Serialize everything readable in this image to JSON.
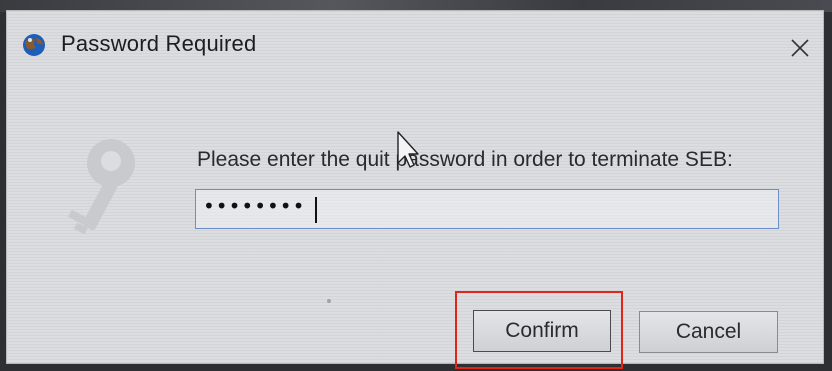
{
  "window": {
    "title": "Password Required",
    "close_glyph": "✕"
  },
  "dialog": {
    "prompt": "Please enter the quit password in order to terminate SEB:",
    "password_masked": "••••••••"
  },
  "buttons": {
    "confirm_label": "Confirm",
    "cancel_label": "Cancel"
  },
  "icons": {
    "app": "seb-app-icon",
    "key": "key-icon",
    "close": "close-icon",
    "cursor": "mouse-pointer-icon"
  },
  "colors": {
    "dialog_bg": "#dcdde0",
    "field_border": "#6d8fc7",
    "highlight": "#e0251b"
  }
}
